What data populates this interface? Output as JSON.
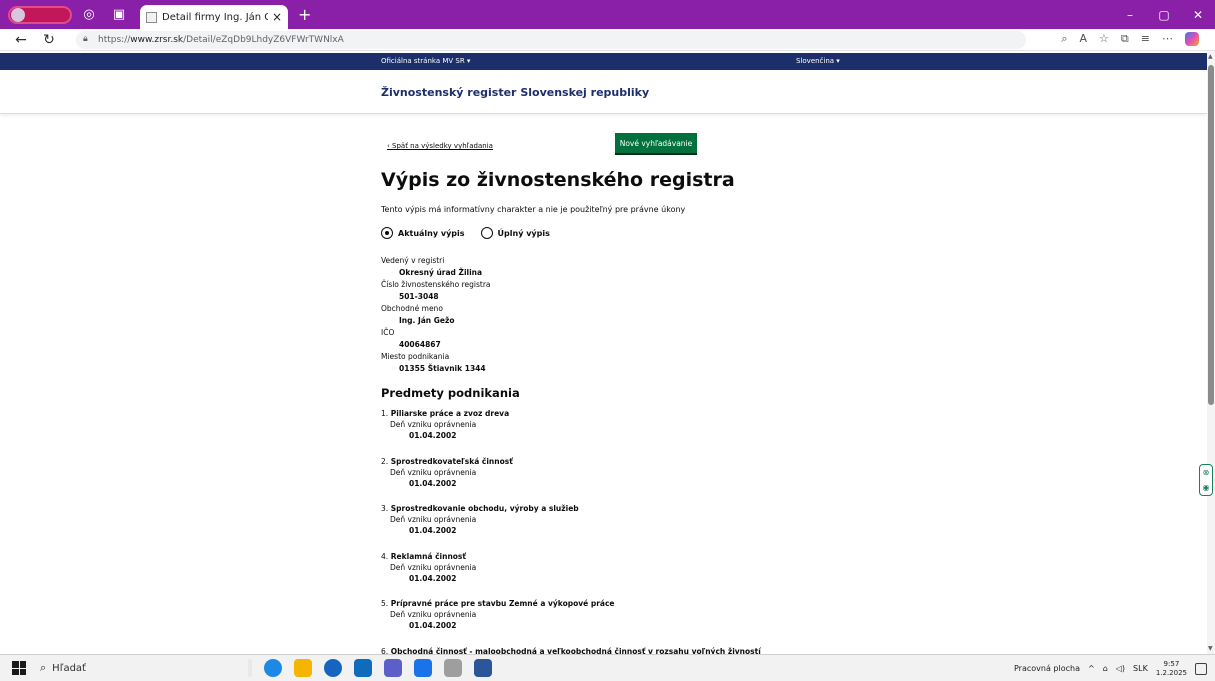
{
  "browser": {
    "tab_title": "Detail firmy Ing. Ján Gežo - Živno",
    "tab_close": "×",
    "new_tab": "+",
    "url_prefix": "https://",
    "url_host": "www.zrsr.sk",
    "url_path": "/Detail/eZqDb9LhdyZ6VFWrTWNlxA",
    "win_min": "–",
    "win_max": "▢",
    "win_close": "✕"
  },
  "header": {
    "official": "Oficiálna stránka MV SR  ▾",
    "language": "Slovenčina  ▾",
    "site_name": "Živnostenský register Slovenskej republiky"
  },
  "page": {
    "back_link": "‹ Späť na výsledky vyhľadania",
    "new_search": "Nové vyhľadávanie",
    "title": "Výpis zo živnostenského registra",
    "notice": "Tento výpis má informatívny charakter a nie je použiteľný pre právne úkony",
    "radio_current": "Aktuálny výpis",
    "radio_full": "Úplný výpis",
    "fields": [
      {
        "label": "Vedený v registri",
        "value": "Okresný úrad Žilina"
      },
      {
        "label": "Číslo živnostenského registra",
        "value": "501-3048"
      },
      {
        "label": "Obchodné meno",
        "value": "Ing. Ján Gežo"
      },
      {
        "label": "IČO",
        "value": "40064867"
      },
      {
        "label": "Miesto podnikania",
        "value": "01355 Štiavnik 1344"
      }
    ],
    "subjects_heading": "Predmety podnikania",
    "subjects": [
      {
        "num": "1.",
        "name": "Piliarske práce a zvoz dreva",
        "label": "Deň vzniku oprávnenia",
        "date": "01.04.2002"
      },
      {
        "num": "2.",
        "name": "Sprostredkovateľská činnosť",
        "label": "Deň vzniku oprávnenia",
        "date": "01.04.2002"
      },
      {
        "num": "3.",
        "name": "Sprostredkovanie obchodu, výroby a služieb",
        "label": "Deň vzniku oprávnenia",
        "date": "01.04.2002"
      },
      {
        "num": "4.",
        "name": "Reklamná činnosť",
        "label": "Deň vzniku oprávnenia",
        "date": "01.04.2002"
      },
      {
        "num": "5.",
        "name": "Prípravné práce pre stavbu Zemné a výkopové práce",
        "label": "Deň vzniku oprávnenia",
        "date": "01.04.2002"
      },
      {
        "num": "6.",
        "name": "Obchodná činnosť - maloobchodná a veľkoobchodná činnosť v rozsahu voľných živností",
        "label": "",
        "date": ""
      }
    ]
  },
  "taskbar": {
    "search_placeholder": "Hľadať",
    "desktop_label": "Pracovná plocha",
    "lang": "SLK",
    "time": "9:57",
    "date": "1.2.2025"
  }
}
